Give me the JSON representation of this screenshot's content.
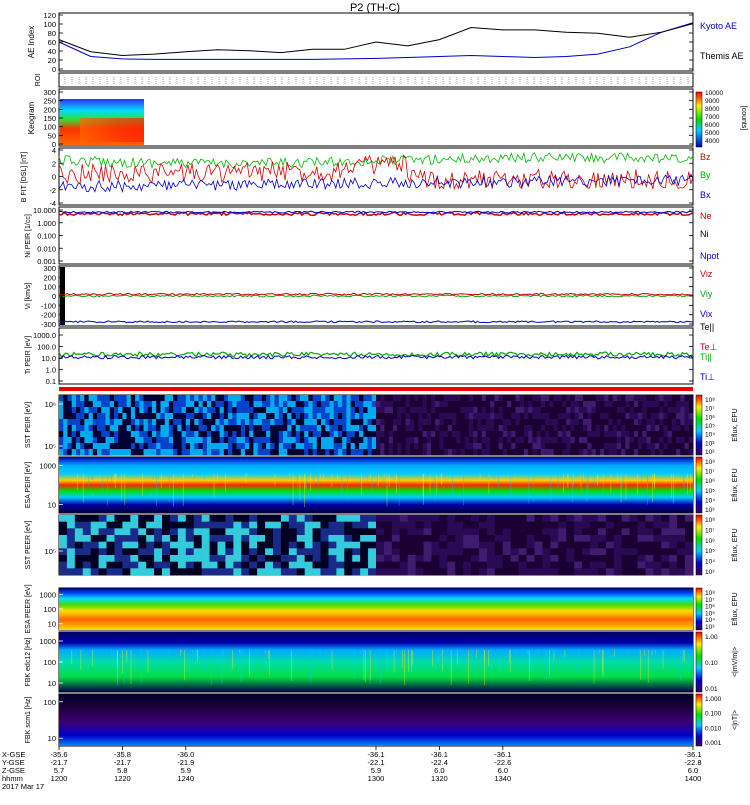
{
  "title": "P2 (TH-C)",
  "chart_data": [
    {
      "type": "line",
      "ylabel": "AE Index",
      "ylim": [
        0,
        120
      ],
      "yticks": [
        "120",
        "100",
        "80",
        "60",
        "40",
        "20",
        "0"
      ],
      "x": [
        1200,
        1210,
        1220,
        1230,
        1240,
        1250,
        1260,
        1270,
        1280,
        1290,
        1300,
        1310,
        1320,
        1330,
        1340,
        1350,
        1360,
        1370,
        1380,
        1390,
        1400
      ],
      "series": [
        {
          "name": "Kyoto AE",
          "color": "#0000cc",
          "values": [
            60,
            30,
            25,
            24,
            24,
            24,
            24,
            24,
            24,
            25,
            26,
            28,
            30,
            32,
            30,
            28,
            30,
            35,
            50,
            80,
            100
          ]
        },
        {
          "name": "Themis AE",
          "color": "#000000",
          "values": [
            65,
            40,
            32,
            35,
            40,
            44,
            42,
            38,
            45,
            45,
            60,
            52,
            65,
            90,
            85,
            85,
            80,
            78,
            70,
            80,
            98
          ]
        }
      ]
    },
    {
      "type": "table",
      "ylabel": "ROI",
      "note": "tick strip",
      "ylim": [
        0,
        0
      ]
    },
    {
      "type": "heatmap",
      "ylabel": "Keogram",
      "yticks": [
        "300",
        "250",
        "200",
        "150",
        "100",
        "50",
        "0"
      ],
      "colorbar_ticks": [
        "10000",
        "9000",
        "8000",
        "7000",
        "6000",
        "5000",
        "4000"
      ],
      "colorbar_label": "[counts]"
    },
    {
      "type": "line",
      "ylabel": "B FIT\n[DSL]\n[nT]",
      "yticks": [
        "4",
        "2",
        "0",
        "-2",
        "-4"
      ],
      "ylim": [
        -4,
        4
      ],
      "series": [
        {
          "name": "Bz",
          "color": "#cc0000"
        },
        {
          "name": "By",
          "color": "#00aa00"
        },
        {
          "name": "Bx",
          "color": "#0000cc"
        }
      ]
    },
    {
      "type": "line",
      "ylabel": "Ni\nPEIR\n[1/cc]",
      "yticks": [
        "10.000",
        "1.000",
        "0.100",
        "0.010",
        "0.001"
      ],
      "series": [
        {
          "name": "Ne",
          "color": "#cc0000"
        },
        {
          "name": "Ni",
          "color": "#000000"
        },
        {
          "name": "Npot",
          "color": "#0000cc"
        }
      ]
    },
    {
      "type": "line",
      "ylabel": "Vi\n[km/s]",
      "yticks": [
        "300",
        "200",
        "100",
        "0",
        "-100",
        "-200",
        "-300"
      ],
      "ylim": [
        -300,
        300
      ],
      "series": [
        {
          "name": "Viz",
          "color": "#cc0000"
        },
        {
          "name": "Viy",
          "color": "#00aa00"
        },
        {
          "name": "Vix",
          "color": "#0000cc"
        },
        {
          "name": "Te||",
          "color": "#000000"
        }
      ]
    },
    {
      "type": "line",
      "ylabel": "Ti\nPEIR\n[eV]",
      "yticks": [
        "1000.0",
        "100.0",
        "10.0",
        "1.0",
        "0.1"
      ],
      "series": [
        {
          "name": "Te⊥",
          "color": "#cc0000"
        },
        {
          "name": "Ti||",
          "color": "#00aa00"
        },
        {
          "name": "Ti⊥",
          "color": "#0000cc"
        }
      ]
    },
    {
      "type": "heatmap",
      "ylabel": "SST\nPEIR\n[eV]",
      "yticks": [
        "10⁶",
        "10⁵"
      ],
      "colorbar_ticks": [
        "10⁸",
        "10⁷",
        "10⁶",
        "10⁵",
        "10⁴",
        "10³",
        "10²"
      ],
      "colorbar_label": "Eflux, EFU"
    },
    {
      "type": "heatmap",
      "ylabel": "ESA\nPEIR\n[eV]",
      "yticks": [
        "1000",
        "10"
      ],
      "colorbar_ticks": [
        "10⁸",
        "10⁷",
        "10⁶",
        "10⁵",
        "10⁴",
        "10³"
      ],
      "colorbar_label": "Eflux, EFU"
    },
    {
      "type": "heatmap",
      "ylabel": "SST\nPEER\n[eV]",
      "yticks": [
        "10⁵"
      ],
      "colorbar_ticks": [
        "10⁸",
        "10⁷",
        "10⁶",
        "10⁵",
        "10⁴",
        "10³"
      ],
      "colorbar_label": "Eflux, EFU"
    },
    {
      "type": "heatmap",
      "ylabel": "ESA\nPEER\n[eV]",
      "yticks": [
        "1000",
        "100",
        "10"
      ],
      "colorbar_ticks": [
        "10⁸",
        "10⁷",
        "10⁶",
        "10⁵",
        "10⁴",
        "10³"
      ],
      "colorbar_label": "Eflux, EFU"
    },
    {
      "type": "heatmap",
      "ylabel": "FBK\nedc12\n[Hz]",
      "yticks": [
        "1000",
        "100",
        "10"
      ],
      "colorbar_ticks": [
        "1.00",
        "0.10",
        "0.01"
      ],
      "colorbar_label": "<|mV/m|>"
    },
    {
      "type": "heatmap",
      "ylabel": "FBK\nscm1\n[Hz]",
      "yticks": [
        "100",
        "10"
      ],
      "colorbar_ticks": [
        "1.000",
        "0.100",
        "0.010",
        "0.001"
      ],
      "colorbar_label": "<|nT|>"
    }
  ],
  "xaxis": {
    "row_labels": [
      "X-GSE",
      "Y-GSE",
      "Z-GSE",
      "hhmm",
      "2017 Mar 17"
    ],
    "columns": [
      {
        "x": "1200",
        "v": [
          "-35.6",
          "-21.7",
          "5.7"
        ]
      },
      {
        "x": "1220",
        "v": [
          "-35.8",
          "-21.7",
          "5.8"
        ]
      },
      {
        "x": "1240",
        "v": [
          "-36.0",
          "-21.9",
          "5.9"
        ]
      },
      {
        "x": "1300",
        "v": [
          "-36.1",
          "-22.1",
          "5.9"
        ]
      },
      {
        "x": "1320",
        "v": [
          "-36.1",
          "-22.4",
          "6.0"
        ]
      },
      {
        "x": "1340",
        "v": [
          "-36.1",
          "-22.6",
          "6.0"
        ]
      },
      {
        "x": "1400",
        "v": [
          "-36.1",
          "-22.8",
          "6.0"
        ]
      }
    ]
  }
}
